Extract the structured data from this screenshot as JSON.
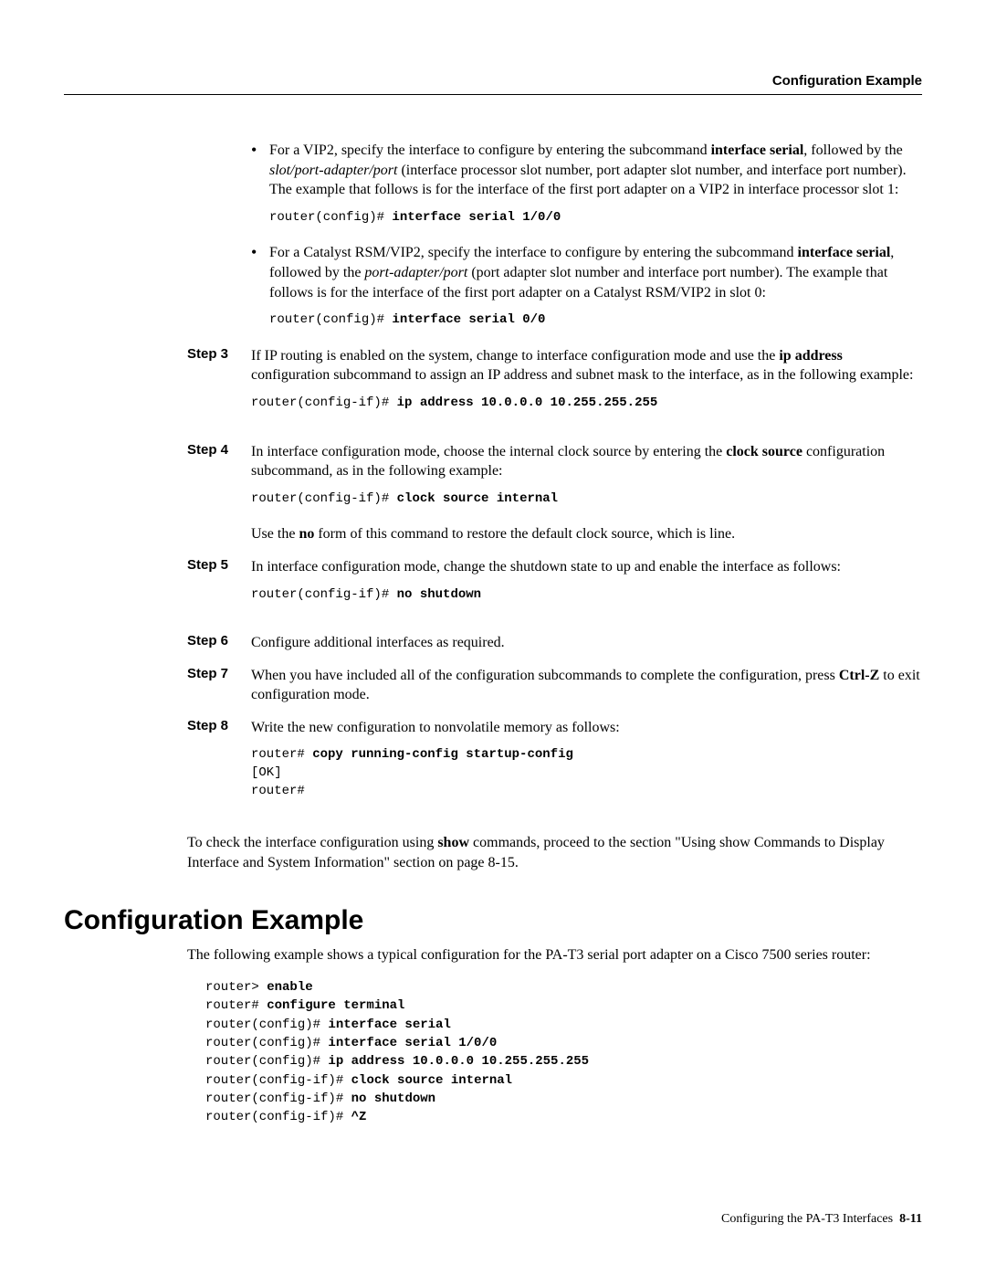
{
  "header": {
    "right": "Configuration Example"
  },
  "bullets": [
    {
      "html": "For a VIP2, specify the interface to configure by entering the subcommand <b>interface serial</b>, followed by the <i>slot/port-adapter/port</i> (interface processor slot number, port adapter slot number, and interface port number). The example that follows is for the interface of the first port adapter on a VIP2 in interface processor slot 1:",
      "code_prefix": "router(config)# ",
      "code_bold": "interface serial 1/0/0"
    },
    {
      "html": "For a Catalyst RSM/VIP2, specify the interface to configure by entering the subcommand <b>interface serial</b>, followed by the <i>port-adapter/port</i> (port adapter slot number and interface port number). The example that follows is for the interface of the first port adapter on a Catalyst RSM/VIP2 in slot 0:",
      "code_prefix": "router(config)# ",
      "code_bold": "interface serial 0/0"
    }
  ],
  "steps": {
    "s3": {
      "label": "Step 3",
      "html": "If IP routing is enabled on the system, change to interface configuration mode and use the <b>ip address</b> configuration subcommand to assign an IP address and subnet mask to the interface, as in the following example:",
      "code_prefix": "router(config-if)# ",
      "code_bold": "ip address 10.0.0.0 10.255.255.255"
    },
    "s4": {
      "label": "Step 4",
      "html": "In interface configuration mode, choose the internal clock source by entering the <b>clock source</b> configuration subcommand, as in the following example:",
      "code_prefix": "router(config-if)# ",
      "code_bold": "clock source internal",
      "post_html": "Use the <b>no</b> form of this command to restore the default clock source, which is line."
    },
    "s5": {
      "label": "Step 5",
      "html": "In interface configuration mode, change the shutdown state to up and enable the interface as follows:",
      "code_prefix": "router(config-if)# ",
      "code_bold": "no shutdown"
    },
    "s6": {
      "label": "Step 6",
      "html": "Configure additional interfaces as required."
    },
    "s7": {
      "label": "Step 7",
      "html": "When you have included all of the configuration subcommands to complete the configuration, press <b>Ctrl-Z</b> to exit configuration mode."
    },
    "s8": {
      "label": "Step 8",
      "html": "Write the new configuration to nonvolatile memory as follows:",
      "code_lines": [
        {
          "prefix": "router# ",
          "bold": "copy running-config startup-config"
        },
        {
          "prefix": "[OK]",
          "bold": ""
        },
        {
          "prefix": "router#",
          "bold": ""
        }
      ]
    }
  },
  "closing": "To check the interface configuration using <b>show</b> commands, proceed to the section \"Using show Commands to Display Interface and System Information\" section on page 8-15.",
  "section": {
    "title": "Configuration Example",
    "intro": "The following example shows a typical configuration for the PA-T3 serial port adapter on a Cisco 7500 series router:",
    "example_lines": [
      {
        "prefix": "router> ",
        "bold": "enable"
      },
      {
        "prefix": "router# ",
        "bold": "configure terminal"
      },
      {
        "prefix": "router(config)# ",
        "bold": "interface serial"
      },
      {
        "prefix": "router(config)# ",
        "bold": "interface serial 1/0/0"
      },
      {
        "prefix": "router(config)# ",
        "bold": "ip address 10.0.0.0 10.255.255.255"
      },
      {
        "prefix": "router(config-if)# ",
        "bold": "clock source internal"
      },
      {
        "prefix": "router(config-if)# ",
        "bold": "no shutdown"
      },
      {
        "prefix": "router(config-if)# ",
        "bold": "^Z"
      }
    ]
  },
  "footer": {
    "text": "Configuring the PA-T3 Interfaces",
    "page": "8-11"
  }
}
